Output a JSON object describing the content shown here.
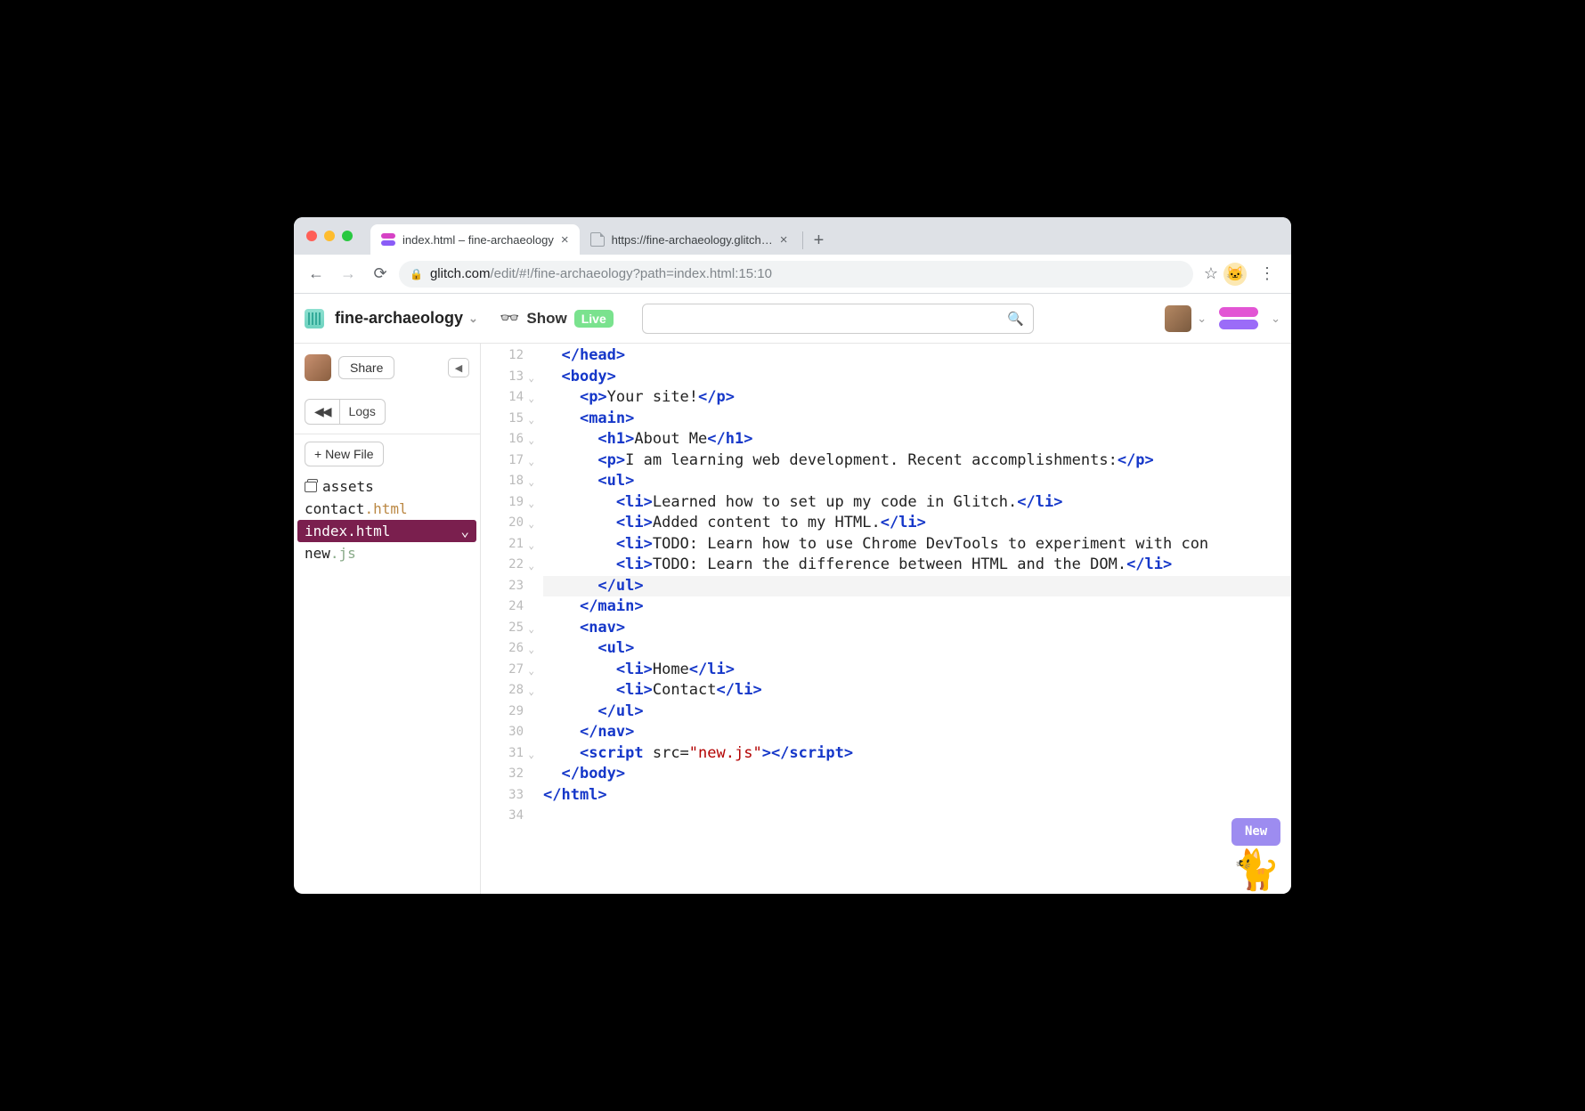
{
  "browser": {
    "tabs": [
      {
        "title": "index.html – fine-archaeology",
        "active": true
      },
      {
        "title": "https://fine-archaeology.glitch…",
        "active": false
      }
    ],
    "url_prefix": "glitch.com",
    "url_rest": "/edit/#!/fine-archaeology?path=index.html:15:10"
  },
  "header": {
    "project": "fine-archaeology",
    "show_label": "Show",
    "live_label": "Live"
  },
  "sidebar": {
    "share": "Share",
    "logs_rewind": "◀◀",
    "logs": "Logs",
    "new_file": "+ New File",
    "files": [
      {
        "name": "assets",
        "kind": "assets"
      },
      {
        "name": "contact",
        "ext": ".html",
        "kind": "file"
      },
      {
        "name": "index",
        "ext": ".html",
        "kind": "file",
        "active": true
      },
      {
        "name": "new",
        "ext": ".js",
        "kind": "file"
      }
    ]
  },
  "mascot": {
    "label": "New"
  },
  "editor": {
    "highlight_line": 23,
    "lines": [
      {
        "n": 12,
        "fold": false,
        "indent": 1,
        "tokens": [
          {
            "t": "tag",
            "v": "</head>"
          }
        ]
      },
      {
        "n": 13,
        "fold": true,
        "indent": 1,
        "tokens": [
          {
            "t": "tag",
            "v": "<body>"
          }
        ]
      },
      {
        "n": 14,
        "fold": true,
        "indent": 2,
        "tokens": [
          {
            "t": "tag",
            "v": "<p>"
          },
          {
            "t": "txt",
            "v": "Your site!"
          },
          {
            "t": "tag",
            "v": "</p>"
          }
        ]
      },
      {
        "n": 15,
        "fold": true,
        "indent": 2,
        "tokens": [
          {
            "t": "tag",
            "v": "<main>"
          }
        ]
      },
      {
        "n": 16,
        "fold": true,
        "indent": 3,
        "tokens": [
          {
            "t": "tag",
            "v": "<h1>"
          },
          {
            "t": "txt",
            "v": "About Me"
          },
          {
            "t": "tag",
            "v": "</h1>"
          }
        ]
      },
      {
        "n": 17,
        "fold": true,
        "indent": 3,
        "tokens": [
          {
            "t": "tag",
            "v": "<p>"
          },
          {
            "t": "txt",
            "v": "I am learning web development. Recent accomplishments:"
          },
          {
            "t": "tag",
            "v": "</p>"
          }
        ]
      },
      {
        "n": 18,
        "fold": true,
        "indent": 3,
        "tokens": [
          {
            "t": "tag",
            "v": "<ul>"
          }
        ]
      },
      {
        "n": 19,
        "fold": true,
        "indent": 4,
        "tokens": [
          {
            "t": "tag",
            "v": "<li>"
          },
          {
            "t": "txt",
            "v": "Learned how to set up my code in Glitch."
          },
          {
            "t": "tag",
            "v": "</li>"
          }
        ]
      },
      {
        "n": 20,
        "fold": true,
        "indent": 4,
        "tokens": [
          {
            "t": "tag",
            "v": "<li>"
          },
          {
            "t": "txt",
            "v": "Added content to my HTML."
          },
          {
            "t": "tag",
            "v": "</li>"
          }
        ]
      },
      {
        "n": 21,
        "fold": true,
        "indent": 4,
        "tokens": [
          {
            "t": "tag",
            "v": "<li>"
          },
          {
            "t": "txt",
            "v": "TODO: Learn how to use Chrome DevTools to experiment with con"
          }
        ]
      },
      {
        "n": 22,
        "fold": true,
        "indent": 4,
        "tokens": [
          {
            "t": "tag",
            "v": "<li>"
          },
          {
            "t": "txt",
            "v": "TODO: Learn the difference between HTML and the DOM."
          },
          {
            "t": "tag",
            "v": "</li>"
          }
        ]
      },
      {
        "n": 23,
        "fold": false,
        "indent": 3,
        "tokens": [
          {
            "t": "tag",
            "v": "</ul>"
          }
        ]
      },
      {
        "n": 24,
        "fold": false,
        "indent": 2,
        "tokens": [
          {
            "t": "tag",
            "v": "</main>"
          }
        ]
      },
      {
        "n": 25,
        "fold": true,
        "indent": 2,
        "tokens": [
          {
            "t": "tag",
            "v": "<nav>"
          }
        ]
      },
      {
        "n": 26,
        "fold": true,
        "indent": 3,
        "tokens": [
          {
            "t": "tag",
            "v": "<ul>"
          }
        ]
      },
      {
        "n": 27,
        "fold": true,
        "indent": 4,
        "tokens": [
          {
            "t": "tag",
            "v": "<li>"
          },
          {
            "t": "txt",
            "v": "Home"
          },
          {
            "t": "tag",
            "v": "</li>"
          }
        ]
      },
      {
        "n": 28,
        "fold": true,
        "indent": 4,
        "tokens": [
          {
            "t": "tag",
            "v": "<li>"
          },
          {
            "t": "txt",
            "v": "Contact"
          },
          {
            "t": "tag",
            "v": "</li>"
          }
        ]
      },
      {
        "n": 29,
        "fold": false,
        "indent": 3,
        "tokens": [
          {
            "t": "tag",
            "v": "</ul>"
          }
        ]
      },
      {
        "n": 30,
        "fold": false,
        "indent": 2,
        "tokens": [
          {
            "t": "tag",
            "v": "</nav>"
          }
        ]
      },
      {
        "n": 31,
        "fold": true,
        "indent": 2,
        "tokens": [
          {
            "t": "tag",
            "v": "<script"
          },
          {
            "t": "attr",
            "v": " src="
          },
          {
            "t": "str",
            "v": "\"new.js\""
          },
          {
            "t": "tag",
            "v": ">"
          },
          {
            "t": "tag",
            "v": "</script>"
          }
        ]
      },
      {
        "n": 32,
        "fold": false,
        "indent": 1,
        "tokens": [
          {
            "t": "tag",
            "v": "</body>"
          }
        ]
      },
      {
        "n": 33,
        "fold": false,
        "indent": 0,
        "tokens": [
          {
            "t": "tag",
            "v": "</html>"
          }
        ]
      },
      {
        "n": 34,
        "fold": false,
        "indent": 0,
        "tokens": []
      }
    ]
  }
}
